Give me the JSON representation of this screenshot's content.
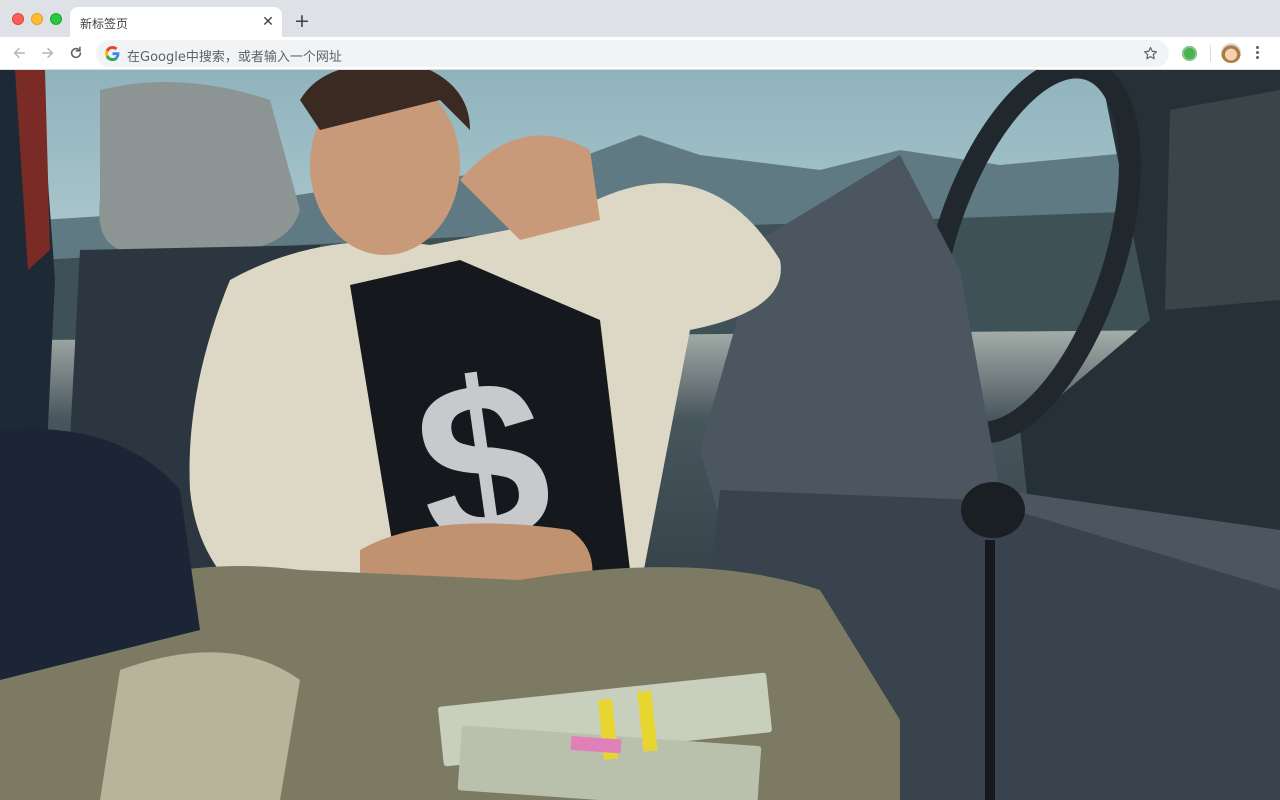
{
  "window": {
    "controls": [
      "close",
      "minimize",
      "maximize"
    ]
  },
  "tab": {
    "title": "新标签页",
    "close_glyph": "✕"
  },
  "new_tab_glyph": "+",
  "omnibox": {
    "placeholder": "在Google中搜索，或者输入一个网址"
  },
  "icons": {
    "back": "arrow-left-icon",
    "forward": "arrow-right-icon",
    "reload": "reload-icon",
    "google": "google-g-icon",
    "bookmark": "star-icon",
    "extension": "green-circle-extension-icon",
    "profile": "avatar-icon",
    "menu": "vertical-dots-menu-icon"
  },
  "colors": {
    "tabstrip": "#dee1e6",
    "omnibox": "#f1f3f4",
    "icon": "#5f6368"
  },
  "wallpaper": {
    "kind": "photo",
    "description_hidden": true
  }
}
